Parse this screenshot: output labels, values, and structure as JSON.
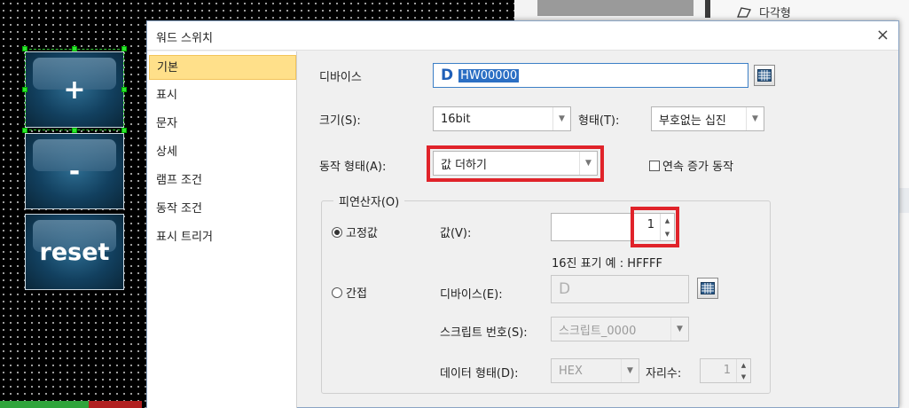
{
  "sidebar_panel": {
    "tool_item": "다각형"
  },
  "hmi_buttons": [
    {
      "label": "+"
    },
    {
      "label": "-"
    },
    {
      "label": "reset"
    }
  ],
  "dialog": {
    "title": "워드 스위치",
    "close_icon": "×",
    "nav": [
      "기본",
      "표시",
      "문자",
      "상세",
      "램프 조건",
      "동작 조건",
      "표시 트리거"
    ],
    "device": {
      "label": "디바이스",
      "prefix": "D",
      "value": "HW00000"
    },
    "size": {
      "label": "크기(S):",
      "value": "16bit"
    },
    "format": {
      "label": "형태(T):",
      "value": "부호없는 십진"
    },
    "operation": {
      "label": "동작 형태(A):",
      "value": "값 더하기"
    },
    "continuous_checkbox": {
      "label": "연속 증가 동작",
      "checked": false
    },
    "operand": {
      "group_title": "피연산자(O)",
      "fixed": {
        "label": "고정값",
        "selected": true
      },
      "value_label": "값(V):",
      "value": "1",
      "hex_hint": "16진 표기 예 : HFFFF",
      "indirect": {
        "label": "간접",
        "selected": false
      },
      "indirect_device_label": "디바이스(E):",
      "indirect_device_prefix": "D",
      "script_label": "스크립트 번호(S):",
      "script_value": "스크립트_0000",
      "data_format_label": "데이터 형태(D):",
      "data_format_value": "HEX",
      "digits_label": "자리수:",
      "digits_value": "1"
    }
  },
  "colors": {
    "highlight_red": "#e0232a",
    "nav_active": "#ffe08a",
    "selection_blue": "#2b6fc4"
  }
}
